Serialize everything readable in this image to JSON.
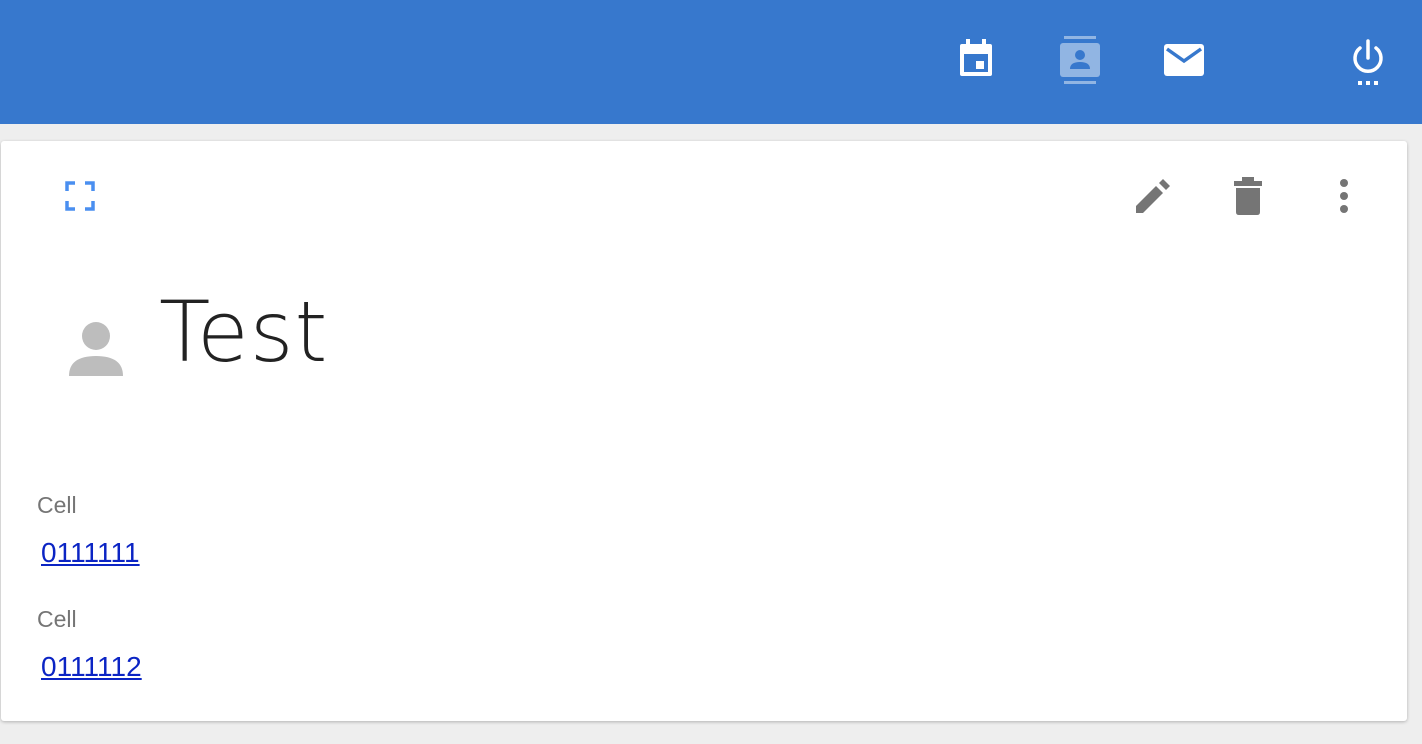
{
  "topbar": {
    "background": "#3778cd",
    "icons": [
      {
        "name": "calendar-icon",
        "active": false
      },
      {
        "name": "contacts-icon",
        "active": true
      },
      {
        "name": "mail-icon",
        "active": false
      },
      {
        "name": "power-icon",
        "active": false
      }
    ]
  },
  "card": {
    "toolbar": {
      "left": [
        "fullscreen-icon"
      ],
      "right": [
        "edit-icon",
        "delete-icon",
        "more-vert-icon"
      ]
    },
    "contact": {
      "name": "Test",
      "avatar_icon": "person-icon"
    },
    "fields": [
      {
        "label": "Cell",
        "value": "0111111"
      },
      {
        "label": "Cell",
        "value": "0111112"
      }
    ]
  },
  "colors": {
    "link": "#0b24c4",
    "label": "#757575",
    "icon_gray": "#757575",
    "accent": "#4a8ff0"
  }
}
